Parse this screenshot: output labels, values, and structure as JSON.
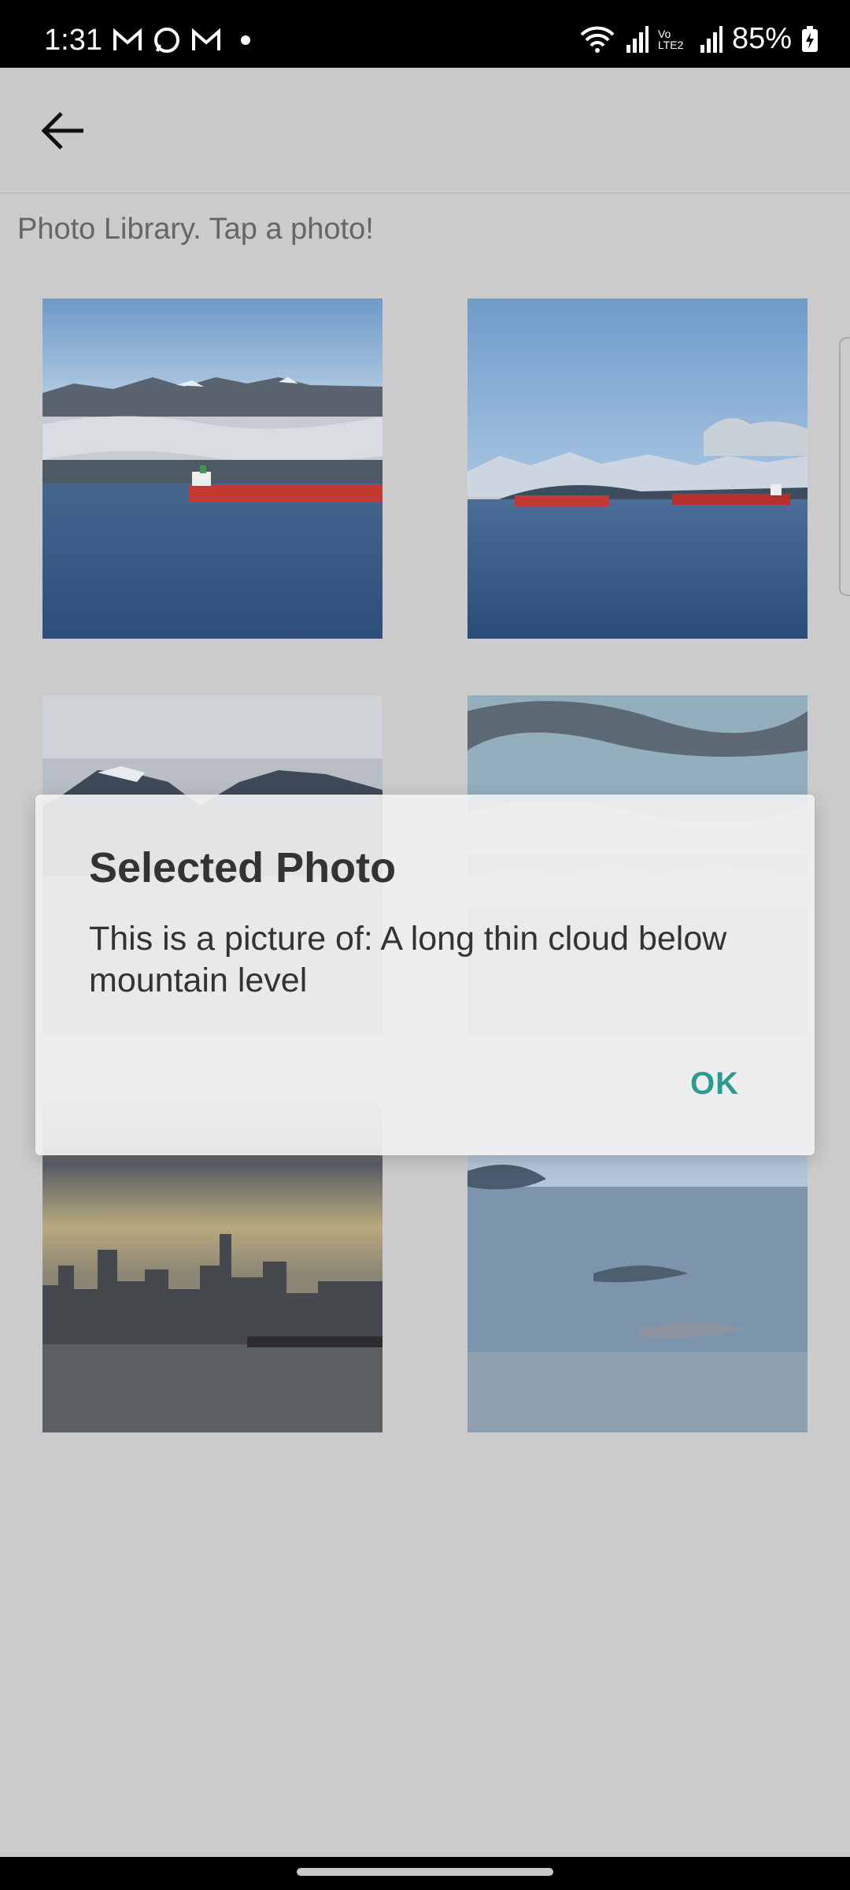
{
  "status_bar": {
    "time": "1:31",
    "battery": "85%",
    "notification_icons": [
      "gmail-icon",
      "whatsapp-icon",
      "gmail-icon"
    ],
    "signal_label": "Vo LTE2"
  },
  "header": {
    "back_icon": "arrow-left-icon"
  },
  "page": {
    "subtitle": "Photo Library. Tap a photo!"
  },
  "photos": [
    {
      "desc": "red cargo ship, low cloud below mountains"
    },
    {
      "desc": "two ships under snowy mountains"
    },
    {
      "desc": "cloudy sky over dark mountains"
    },
    {
      "desc": "hazy snowy mountains over water"
    },
    {
      "desc": "city skyline at dusk"
    },
    {
      "desc": "cloudy blue sky"
    }
  ],
  "dialog": {
    "title": "Selected Photo",
    "message": "This is a picture of: A long thin cloud below mountain level",
    "ok_label": "OK",
    "accent_color": "#2a9d92"
  }
}
